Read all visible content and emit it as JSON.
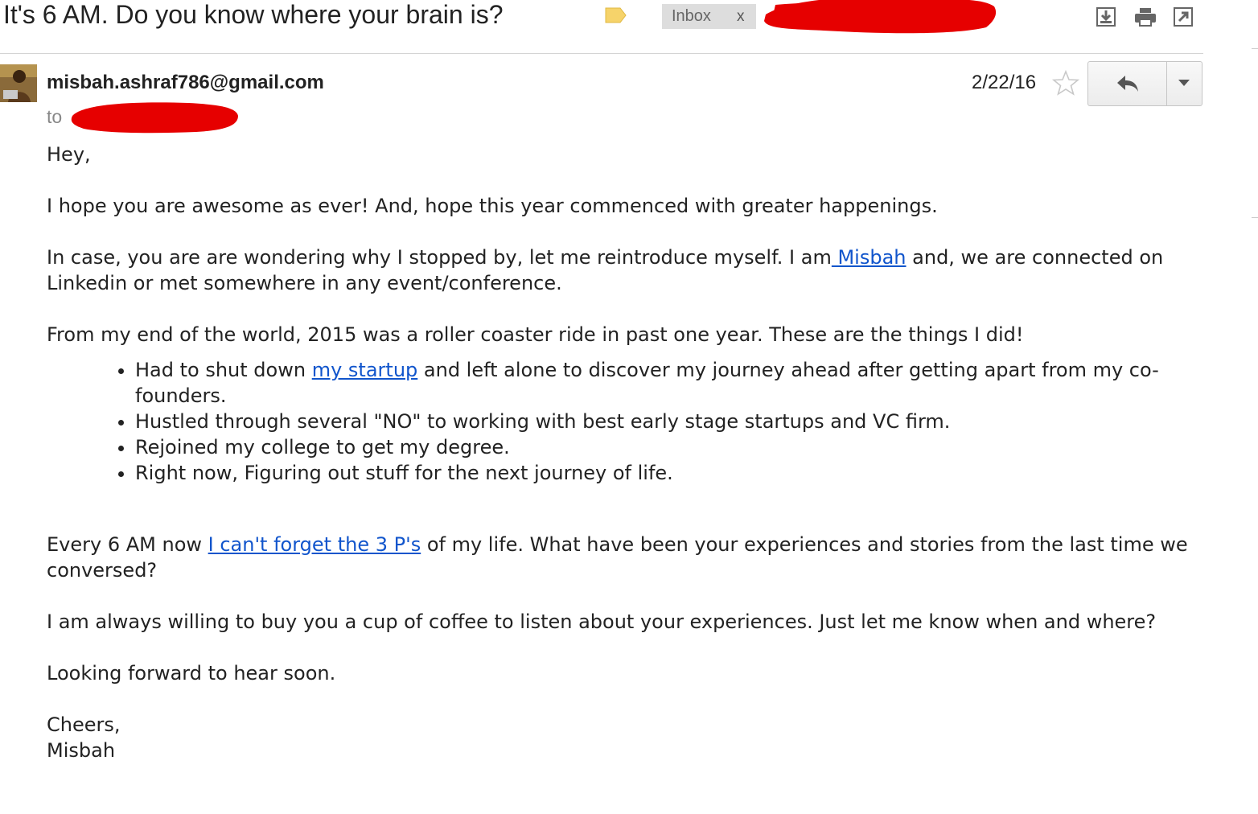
{
  "header": {
    "subject": "It's 6 AM. Do you know where your brain is?",
    "label_chip": "Inbox",
    "label_chip_close": "x",
    "redacted_label": "[redacted]",
    "label_icon": "label-tag-icon",
    "actions": [
      {
        "name": "download-icon"
      },
      {
        "name": "print-icon"
      },
      {
        "name": "open-in-new-window-icon"
      }
    ]
  },
  "message": {
    "sender": "misbah.ashraf786@gmail.com",
    "to_label": "to",
    "recipient": "[redacted]",
    "date": "2/22/16",
    "star_icon": "star-icon",
    "reply_icon": "reply-icon",
    "more_icon": "dropdown-arrow-icon"
  },
  "body": {
    "greeting": "Hey,",
    "p1": "I hope you are awesome as ever! And, hope this year commenced with greater happenings.",
    "p2_before": "In case, you are are wondering why I stopped by, let me reintroduce myself. I am",
    "p2_link": " Misbah",
    "p2_after": " and, we are connected on Linkedin or met somewhere in any event/conference.",
    "p3": "From my end of the world, 2015 was a roller coaster ride in past one year. These are the things I did!",
    "bullet1_before": "Had to shut down ",
    "bullet1_link": "my startup",
    "bullet1_after": " and left alone to discover my journey ahead after getting apart from my co-founders.",
    "bullet2": "Hustled through several \"NO\" to working with best early stage startups and VC firm.",
    "bullet3": "Rejoined my college to get my degree.",
    "bullet4": "Right now, Figuring out stuff for the next journey of life.",
    "p4_before": "Every 6 AM now ",
    "p4_link": "I can't forget the 3 P's",
    "p4_after": " of my life. What have been your experiences and stories from the last time we conversed?",
    "p5": "I am always willing to buy you a cup of coffee to listen about your experiences. Just let me know when and where?",
    "p6": "Looking forward to hear soon.",
    "signoff": "Cheers,",
    "signature": "Misbah"
  },
  "colors": {
    "link": "#1155cc",
    "redaction": "#e60000",
    "label_tag": "#f6d36a",
    "chip_bg": "#dddddd"
  }
}
